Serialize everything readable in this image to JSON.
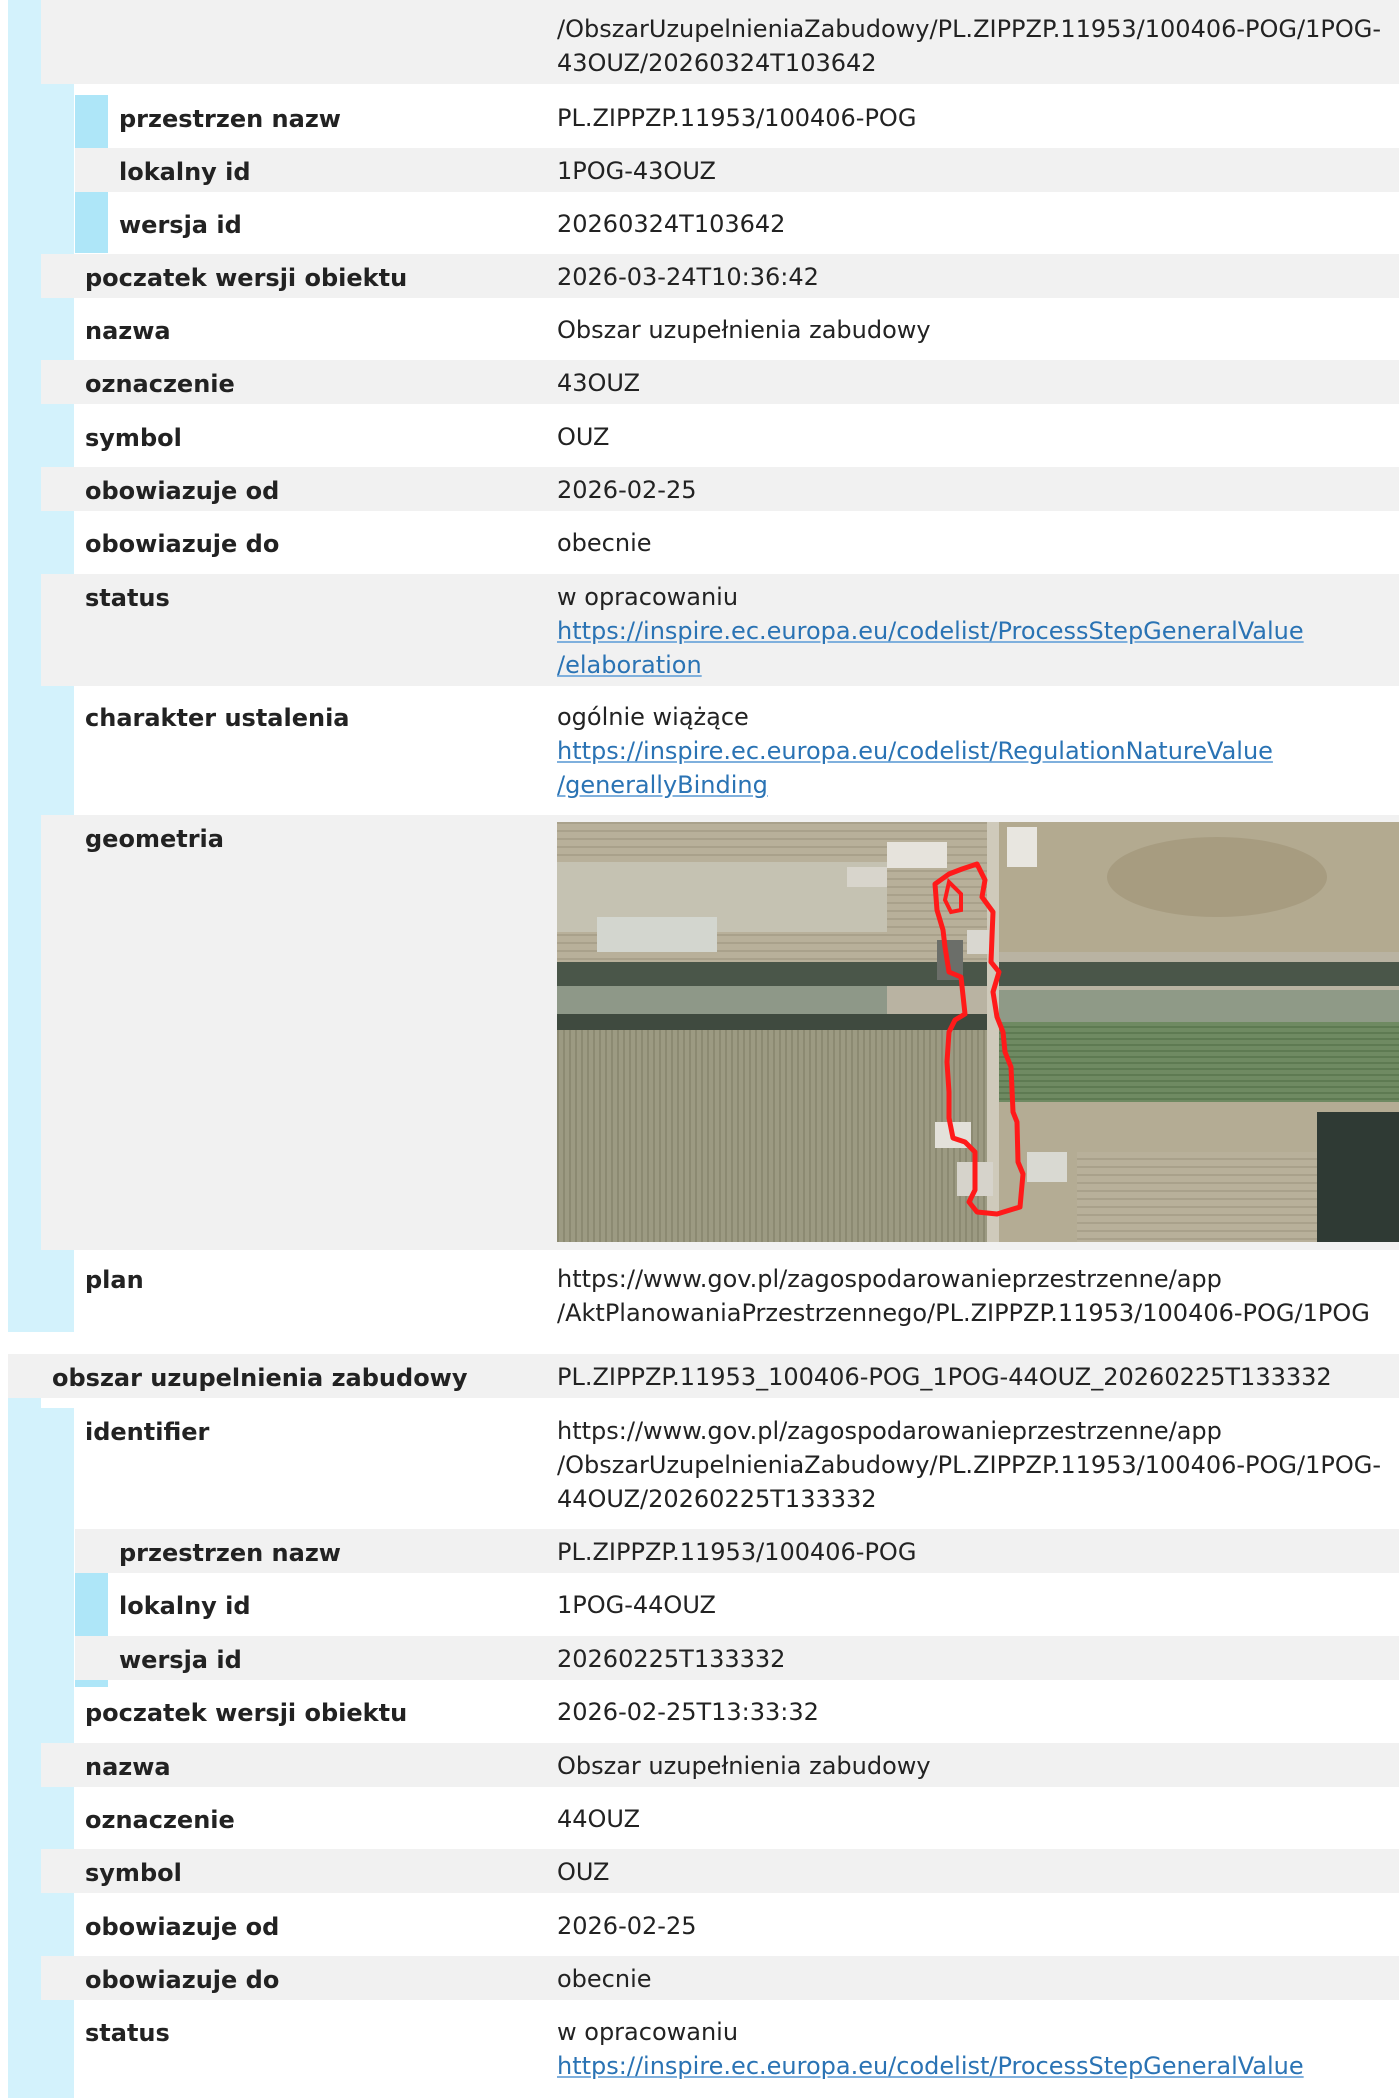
{
  "record1": {
    "identifier_lines": [
      "/ObszarUzupelnieniaZabudowy/PL.ZIPPZP.11953/100406-POG/1POG-",
      "43OUZ/20260324T103642"
    ],
    "fields": {
      "przestrzen_nazw": {
        "label": "przestrzen nazw",
        "value": "PL.ZIPPZP.11953/100406-POG"
      },
      "lokalny_id": {
        "label": "lokalny id",
        "value": "1POG-43OUZ"
      },
      "wersja_id": {
        "label": "wersja id",
        "value": "20260324T103642"
      },
      "poczatek": {
        "label": "poczatek wersji obiektu",
        "value": "2026-03-24T10:36:42"
      },
      "nazwa": {
        "label": "nazwa",
        "value": "Obszar uzupełnienia zabudowy"
      },
      "oznaczenie": {
        "label": "oznaczenie",
        "value": "43OUZ"
      },
      "symbol": {
        "label": "symbol",
        "value": "OUZ"
      },
      "od": {
        "label": "obowiazuje od",
        "value": "2026-02-25"
      },
      "do": {
        "label": "obowiazuje do",
        "value": "obecnie"
      },
      "status": {
        "label": "status",
        "value": "w opracowaniu",
        "link1": "https://inspire.ec.europa.eu/codelist/ProcessStepGeneralValue",
        "link2": "/elaboration"
      },
      "charakter": {
        "label": "charakter ustalenia",
        "value": "ogólnie wiążące",
        "link1": "https://inspire.ec.europa.eu/codelist/RegulationNatureValue",
        "link2": "/generallyBinding"
      },
      "geometria": {
        "label": "geometria"
      },
      "plan": {
        "label": "plan",
        "line1": "https://www.gov.pl/zagospodarowanieprzestrzenne/app",
        "line2": "/AktPlanowaniaPrzestrzennego/PL.ZIPPZP.11953/100406-POG/1POG"
      }
    }
  },
  "record2": {
    "type_label": "obszar uzupelnienia zabudowy",
    "type_value": "PL.ZIPPZP.11953_100406-POG_1POG-44OUZ_20260225T133332",
    "identifier": {
      "label": "identifier",
      "lines": [
        "https://www.gov.pl/zagospodarowanieprzestrzenne/app",
        "/ObszarUzupelnieniaZabudowy/PL.ZIPPZP.11953/100406-POG/1POG-",
        "44OUZ/20260225T133332"
      ]
    },
    "fields": {
      "przestrzen_nazw": {
        "label": "przestrzen nazw",
        "value": "PL.ZIPPZP.11953/100406-POG"
      },
      "lokalny_id": {
        "label": "lokalny id",
        "value": "1POG-44OUZ"
      },
      "wersja_id": {
        "label": "wersja id",
        "value": "20260225T133332"
      },
      "poczatek": {
        "label": "poczatek wersji obiektu",
        "value": "2026-02-25T13:33:32"
      },
      "nazwa": {
        "label": "nazwa",
        "value": "Obszar uzupełnienia zabudowy"
      },
      "oznaczenie": {
        "label": "oznaczenie",
        "value": "44OUZ"
      },
      "symbol": {
        "label": "symbol",
        "value": "OUZ"
      },
      "od": {
        "label": "obowiazuje od",
        "value": "2026-02-25"
      },
      "do": {
        "label": "obowiazuje do",
        "value": "obecnie"
      },
      "status": {
        "label": "status",
        "value": "w opracowaniu",
        "link1": "https://inspire.ec.europa.eu/codelist/ProcessStepGeneralValue"
      }
    }
  },
  "colors": {
    "accent_light": "#d3f2fc",
    "accent": "#aee6f8",
    "link": "#2a73b4",
    "row_shade": "#f1f1f1",
    "geometry_outline": "#ff1a1a"
  }
}
